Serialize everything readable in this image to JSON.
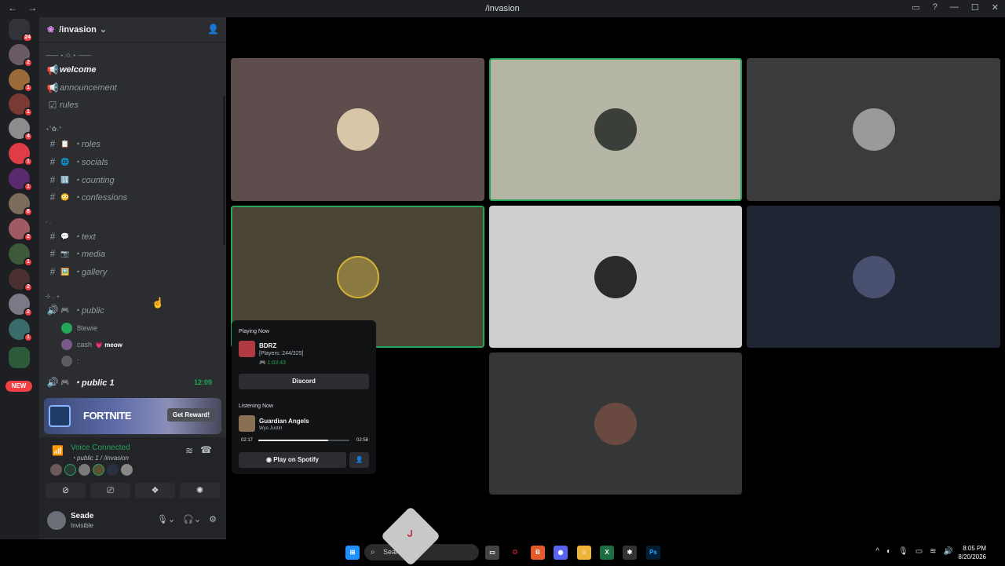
{
  "window": {
    "title": "/invasion",
    "back": "←",
    "forward": "→"
  },
  "server": {
    "name": "/invasion"
  },
  "rail_badges": [
    "24",
    "2",
    "1",
    "1",
    "4",
    "1",
    "1",
    "8",
    "2",
    "1",
    "2",
    "2",
    "1"
  ],
  "new_label": "NEW",
  "categories": [
    "—— ⋆.✩.⋆ ——",
    "⋆˚✿˖°",
    "- .",
    "⊹ . ⋆"
  ],
  "channels": [
    {
      "name": "welcome",
      "emoji": ""
    },
    {
      "name": "announcement",
      "emoji": ""
    },
    {
      "name": "rules",
      "emoji": ""
    },
    {
      "name": "・roles",
      "emoji": "📋"
    },
    {
      "name": "・socials",
      "emoji": "🌐"
    },
    {
      "name": "・counting",
      "emoji": "🔢"
    },
    {
      "name": "・confessions",
      "emoji": "😳"
    },
    {
      "name": "・text",
      "emoji": "💬"
    },
    {
      "name": "・media",
      "emoji": "📷"
    },
    {
      "name": "・gallery",
      "emoji": "🖼️"
    },
    {
      "name": "・public",
      "emoji": "🎮"
    },
    {
      "name": "・public 1",
      "emoji": "🎮",
      "time": "12:09"
    }
  ],
  "voice_users": [
    {
      "name": "8tewie",
      "tag": ""
    },
    {
      "name": "cash",
      "tag": "💗 meow"
    },
    {
      "name": ":",
      "tag": ""
    }
  ],
  "promo": {
    "brand": "FORTNITE",
    "button": "Get Reward!"
  },
  "voice_panel": {
    "status": "Voice Connected",
    "location": "・public 1 / /invasion"
  },
  "user": {
    "name": "Seade",
    "status": "Invisible"
  },
  "popout": {
    "playing_heading": "Playing Now",
    "game": "BDRZ",
    "game_detail": "[Players: 244/325]",
    "game_time": "1:03:43",
    "button": "Discord",
    "listening_heading": "Listening Now",
    "song": "Guardian Angels",
    "artist": "Wyo Justin",
    "elapsed": "02:17",
    "duration": "02:58",
    "progress": 0.77,
    "spotify_button": "Play on Spotify"
  },
  "taskbar": {
    "search_placeholder": "Search",
    "diamond_char": "ᒍ",
    "time": "8:05 PM",
    "date": "8/20/2026"
  },
  "tile_colors": [
    "#5d4d4d",
    "#b5b5a6",
    "#3b3b3b",
    "#4a4435",
    "#cfcfcf",
    "#1f2533",
    "#343638"
  ]
}
